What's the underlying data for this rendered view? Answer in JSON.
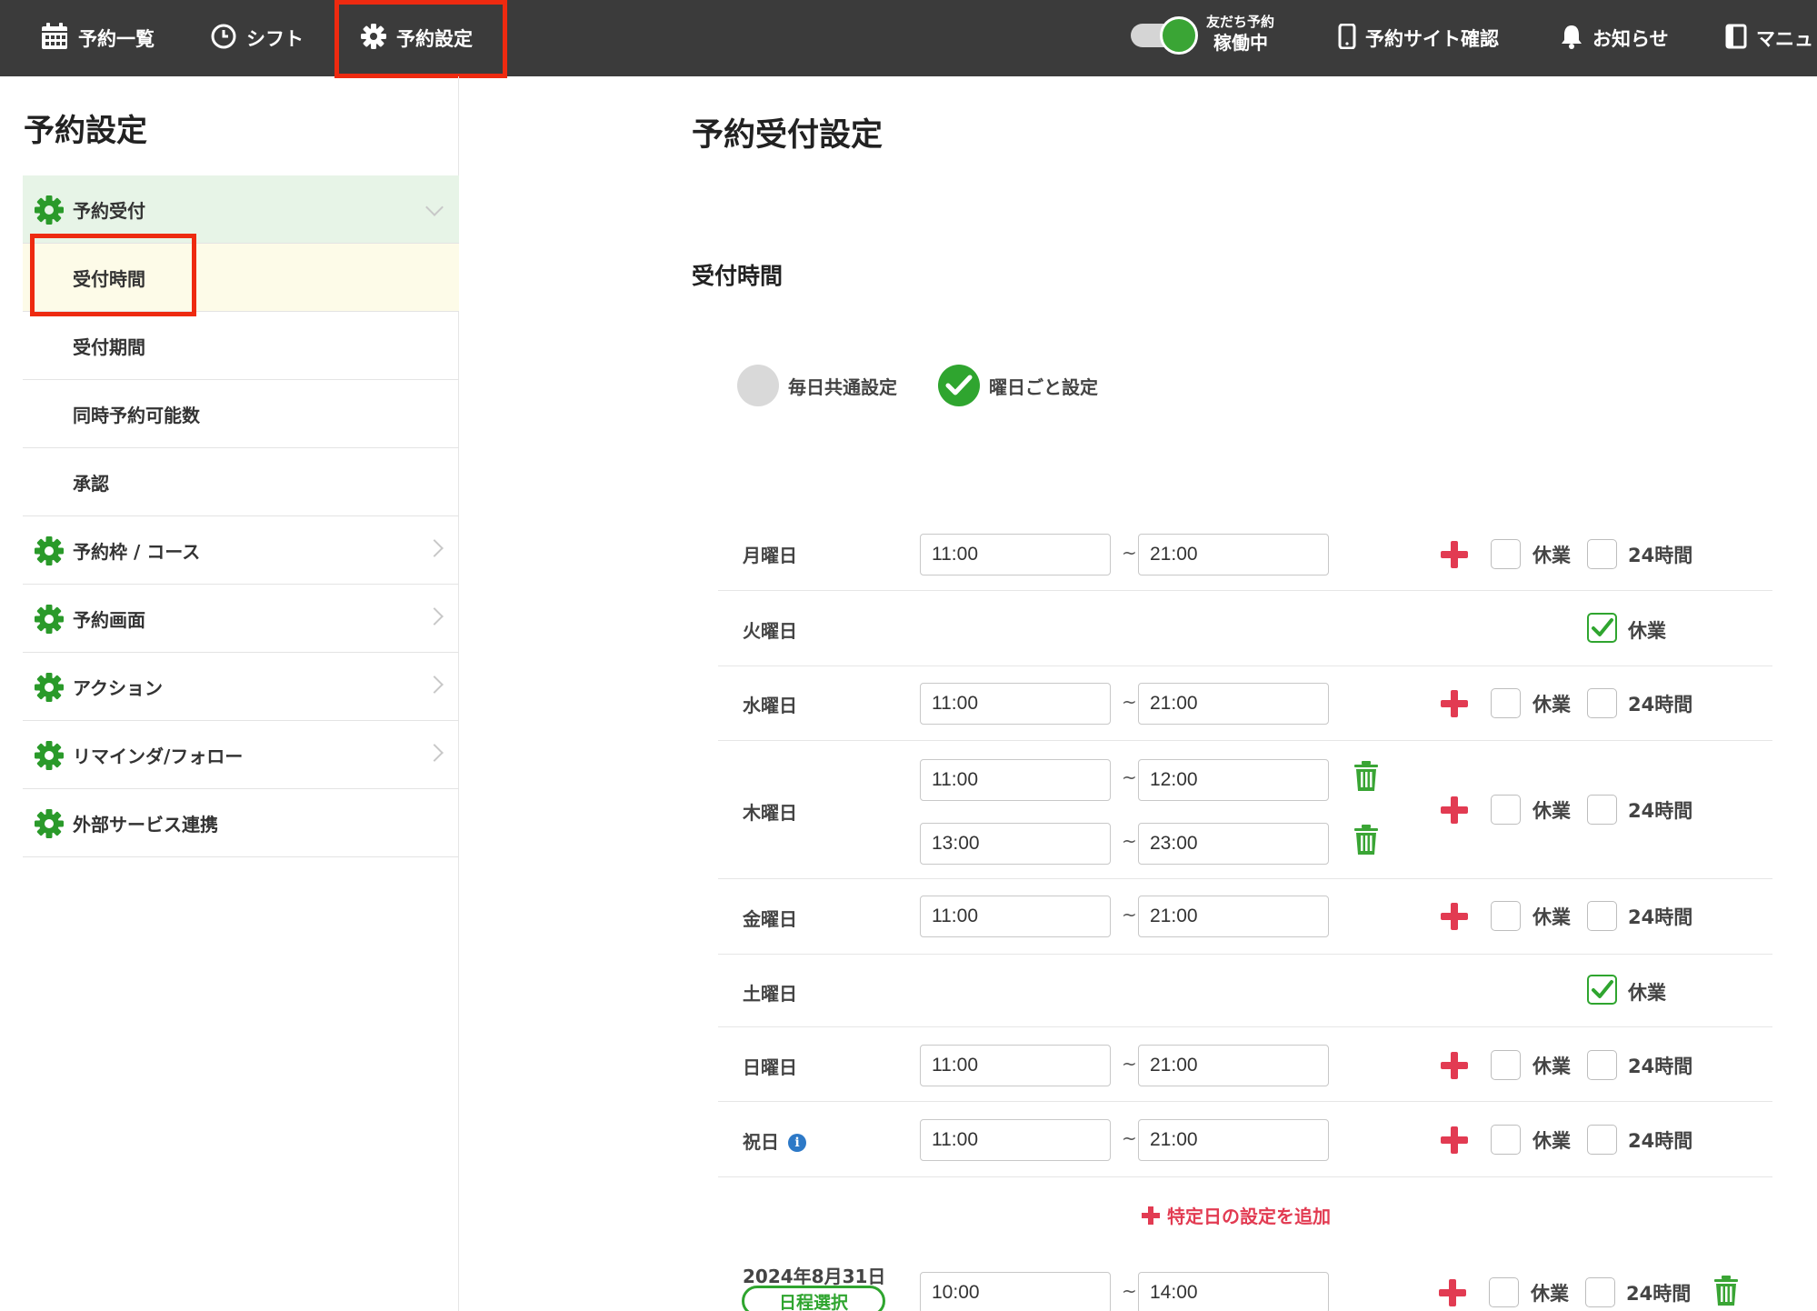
{
  "topbar": {
    "nav": [
      {
        "label": "予約一覧",
        "icon": "calendar-icon"
      },
      {
        "label": "シフト",
        "icon": "clock-icon"
      },
      {
        "label": "予約設定",
        "icon": "gear-icon"
      }
    ],
    "toggle": {
      "small_label": "友だち予約",
      "status": "稼働中"
    },
    "right_nav": [
      {
        "label": "予約サイト確認",
        "icon": "smartphone-icon"
      },
      {
        "label": "お知らせ",
        "icon": "bell-icon"
      },
      {
        "label": "マニュ",
        "icon": "book-icon"
      }
    ]
  },
  "colors": {
    "accent_green": "#2fa52f",
    "highlight_red": "#ee2a10",
    "plus_red": "#e23b52",
    "topbar_bg": "#3b3b3b"
  },
  "sidebar": {
    "title": "予約設定",
    "items": [
      {
        "label": "予約受付",
        "type": "parent",
        "expanded": true
      },
      {
        "label": "受付時間",
        "type": "child",
        "selected": true
      },
      {
        "label": "受付期間",
        "type": "child"
      },
      {
        "label": "同時予約可能数",
        "type": "child"
      },
      {
        "label": "承認",
        "type": "child"
      },
      {
        "label": "予約枠 / コース",
        "type": "parent"
      },
      {
        "label": "予約画面",
        "type": "parent"
      },
      {
        "label": "アクション",
        "type": "parent"
      },
      {
        "label": "リマインダ/フォロー",
        "type": "parent"
      },
      {
        "label": "外部サービス連携",
        "type": "parent"
      }
    ]
  },
  "main": {
    "title": "予約受付設定",
    "section": "受付時間",
    "modes": [
      {
        "label": "毎日共通設定",
        "selected": false
      },
      {
        "label": "曜日ごと設定",
        "selected": true
      }
    ],
    "labels": {
      "tilde": "~",
      "closed": "休業",
      "allday": "24時間",
      "add_special": "特定日の設定を追加",
      "date_badge": "日程選択",
      "info": "i"
    },
    "days": [
      {
        "name": "月曜日",
        "slots": [
          {
            "start": "11:00",
            "end": "21:00"
          }
        ],
        "closed": false
      },
      {
        "name": "火曜日",
        "slots": [],
        "closed": true
      },
      {
        "name": "水曜日",
        "slots": [
          {
            "start": "11:00",
            "end": "21:00"
          }
        ],
        "closed": false
      },
      {
        "name": "木曜日",
        "slots": [
          {
            "start": "11:00",
            "end": "12:00"
          },
          {
            "start": "13:00",
            "end": "23:00"
          }
        ],
        "closed": false
      },
      {
        "name": "金曜日",
        "slots": [
          {
            "start": "11:00",
            "end": "21:00"
          }
        ],
        "closed": false
      },
      {
        "name": "土曜日",
        "slots": [],
        "closed": true
      },
      {
        "name": "日曜日",
        "slots": [
          {
            "start": "11:00",
            "end": "21:00"
          }
        ],
        "closed": false
      },
      {
        "name": "祝日",
        "slots": [
          {
            "start": "11:00",
            "end": "21:00"
          }
        ],
        "closed": false
      }
    ],
    "special": [
      {
        "date": "2024年8月31日",
        "slots": [
          {
            "start": "10:00",
            "end": "14:00"
          }
        ],
        "closed": false
      }
    ]
  }
}
